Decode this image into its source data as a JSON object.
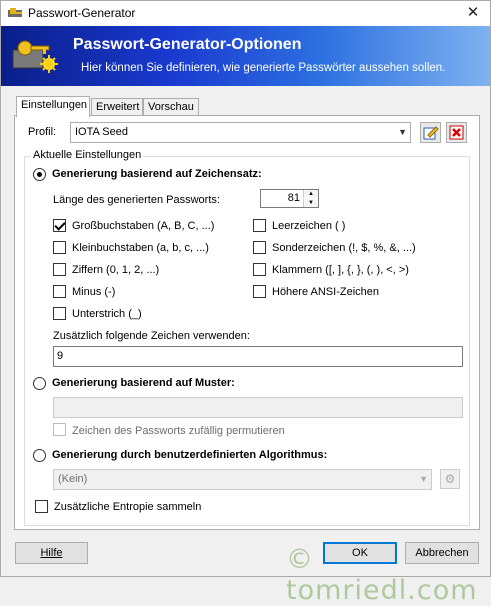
{
  "window": {
    "title": "Passwort-Generator",
    "close_glyph": "✕"
  },
  "banner": {
    "title": "Passwort-Generator-Optionen",
    "subtitle": "Hier können Sie definieren, wie generierte Passwörter aussehen sollen."
  },
  "tabs": [
    {
      "label": "Einstellungen",
      "active": true
    },
    {
      "label": "Erweitert",
      "active": false
    },
    {
      "label": "Vorschau",
      "active": false
    }
  ],
  "profile": {
    "label": "Profil:",
    "value": "IOTA Seed"
  },
  "current_settings": {
    "legend": "Aktuelle Einstellungen",
    "charset_mode": {
      "label": "Generierung basierend auf Zeichensatz:",
      "checked": true
    },
    "length": {
      "label": "Länge des generierten Passworts:",
      "value": "81"
    },
    "options_left": [
      {
        "label": "Großbuchstaben (A, B, C, ...)",
        "checked": true
      },
      {
        "label": "Kleinbuchstaben (a, b, c, ...)",
        "checked": false
      },
      {
        "label": "Ziffern (0, 1, 2, ...)",
        "checked": false
      },
      {
        "label": "Minus (-)",
        "checked": false
      },
      {
        "label": "Unterstrich (_)",
        "checked": false
      }
    ],
    "options_right": [
      {
        "label": "Leerzeichen ( )",
        "checked": false
      },
      {
        "label": "Sonderzeichen (!, $, %, &, ...)",
        "checked": false
      },
      {
        "label": "Klammern ([, ], {, }, (, ), <, >)",
        "checked": false
      },
      {
        "label": "Höhere ANSI-Zeichen",
        "checked": false
      }
    ],
    "additional_chars": {
      "label": "Zusätzlich folgende Zeichen verwenden:",
      "value": "9"
    },
    "pattern_mode": {
      "label": "Generierung basierend auf Muster:",
      "checked": false,
      "value": ""
    },
    "permute": {
      "label": "Zeichen des Passworts zufällig permutieren",
      "checked": false
    },
    "algorithm_mode": {
      "label": "Generierung durch benutzerdefinierten Algorithmus:",
      "checked": false,
      "value": "(Kein)"
    },
    "entropy": {
      "label": "Zusätzliche Entropie sammeln",
      "checked": false
    }
  },
  "buttons": {
    "help": "Hilfe",
    "ok": "OK",
    "cancel": "Abbrechen"
  },
  "watermark": "tomriedl.com",
  "colors": {
    "banner_start": "#0a1e8a",
    "banner_end": "#7fb2f0",
    "accent": "#0078d7"
  },
  "icons": [
    "app-key-icon",
    "close-icon",
    "banner-keys-icon",
    "dropdown-arrow-icon",
    "edit-profile-icon",
    "delete-profile-icon",
    "spin-up-icon",
    "spin-down-icon",
    "settings-gear-icon"
  ]
}
